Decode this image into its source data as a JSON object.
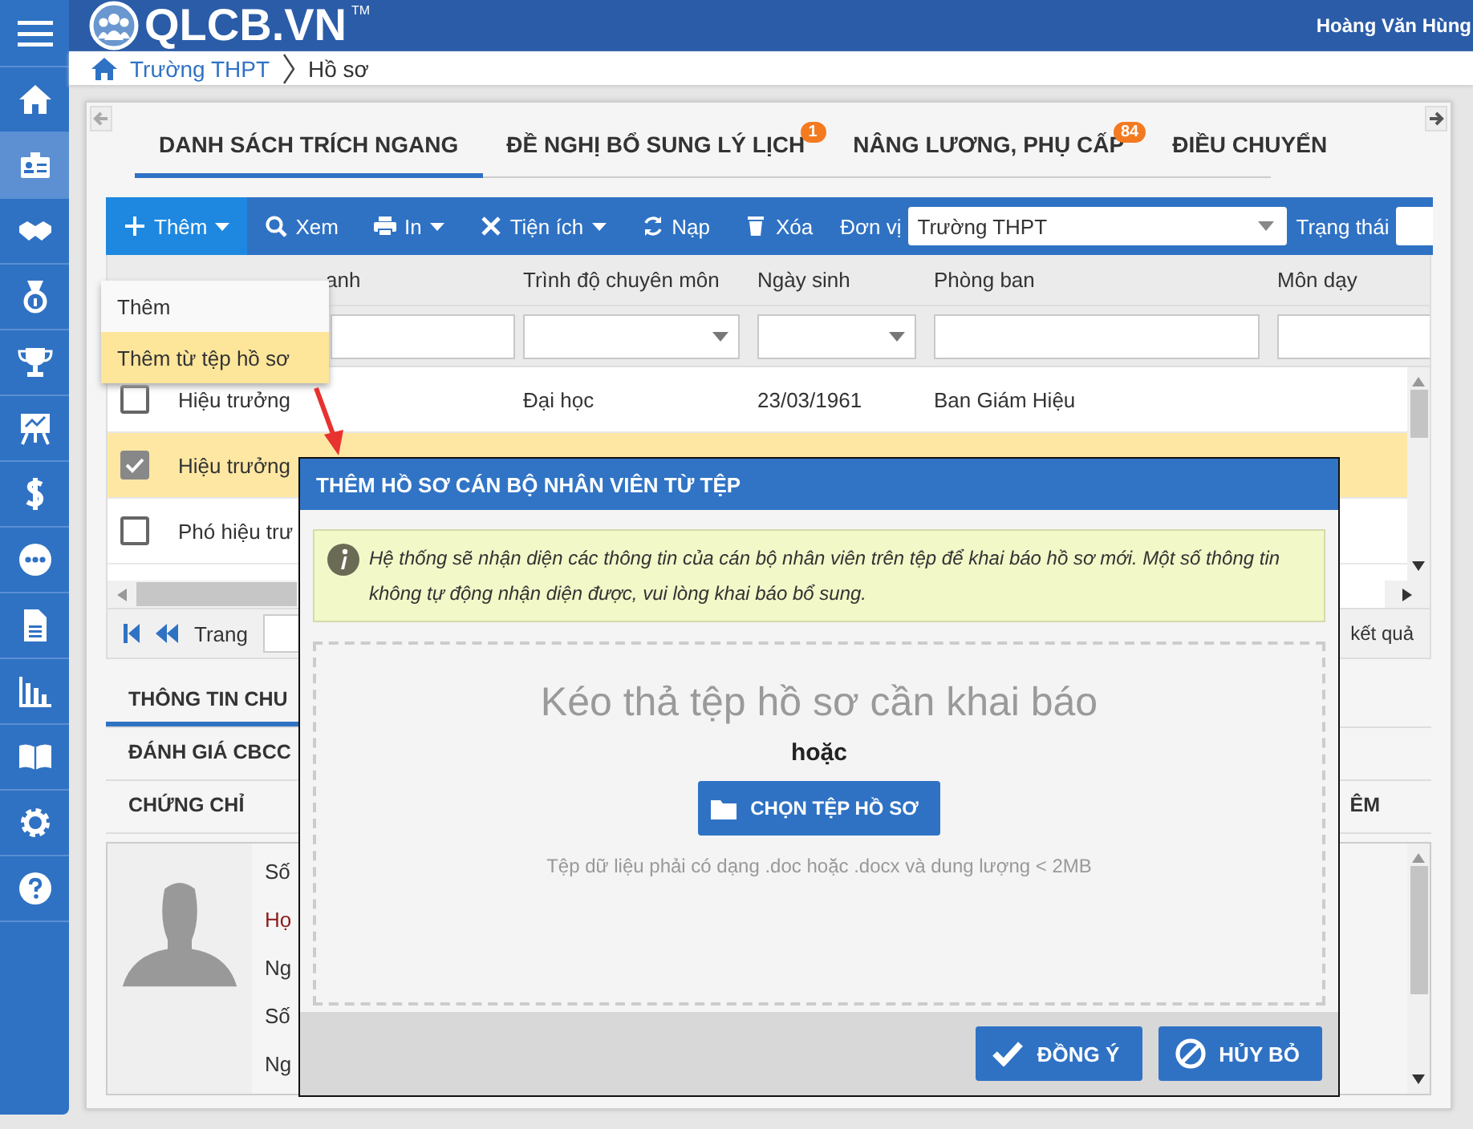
{
  "header": {
    "logo": "QLCB.VN",
    "trademark": "TM",
    "user": "Hoàng Văn Hùng"
  },
  "sidebar": {
    "items": [
      {
        "selected": false
      },
      {
        "selected": true
      },
      {
        "selected": false
      },
      {
        "selected": false
      },
      {
        "selected": false
      },
      {
        "selected": false
      },
      {
        "selected": false
      },
      {
        "selected": false
      },
      {
        "selected": false
      },
      {
        "selected": false
      },
      {
        "selected": false
      },
      {
        "selected": false
      },
      {
        "selected": false
      }
    ]
  },
  "breadcrumb": [
    "Trường THPT",
    "Hồ sơ"
  ],
  "tabs": [
    {
      "label": "DANH SÁCH TRÍCH NGANG",
      "selected": true
    },
    {
      "label": "ĐỀ NGHỊ BỔ SUNG LÝ LỊCH",
      "badge": "1",
      "selected": false
    },
    {
      "label": "NÂNG LƯƠNG, PHỤ CẤP",
      "badge": "84",
      "selected": false
    },
    {
      "label": "ĐIỀU CHUYỂN",
      "selected": false
    }
  ],
  "toolbar": {
    "buttons": [
      {
        "kind": "add",
        "label": "Thêm",
        "caret": true,
        "active": true
      },
      {
        "kind": "view",
        "label": "Xem",
        "caret": false,
        "active": false
      },
      {
        "kind": "print",
        "label": "In",
        "caret": true,
        "active": false
      },
      {
        "kind": "tools",
        "label": "Tiện ích",
        "caret": true,
        "active": false
      },
      {
        "kind": "reload",
        "label": "Nạp",
        "caret": false,
        "active": false
      },
      {
        "kind": "delete",
        "label": "Xóa",
        "caret": false,
        "active": false
      }
    ],
    "unit_label": "Đơn vị",
    "unit_value": "Trường THPT",
    "status_label": "Trạng thái"
  },
  "add_menu": [
    {
      "label": "Thêm",
      "selected": false
    },
    {
      "label": "Thêm từ tệp hồ sơ",
      "selected": true
    }
  ],
  "table": {
    "columns": [
      "anh",
      "Trình độ chuyên môn",
      "Ngày sinh",
      "Phòng ban",
      "Môn dạy"
    ],
    "rows": [
      {
        "checked": false,
        "selected": false,
        "cells": [
          "Hiệu trưởng",
          "Đại học",
          "23/03/1961",
          "Ban Giám Hiệu"
        ]
      },
      {
        "checked": true,
        "selected": true,
        "cells": [
          "Hiệu trưởng"
        ]
      },
      {
        "checked": false,
        "selected": false,
        "cells": [
          "Phó hiệu trư"
        ]
      }
    ]
  },
  "pager": {
    "label": "Trang",
    "result": "kết quả"
  },
  "detail_tabs": [
    [
      {
        "label": "THÔNG TIN CHU",
        "selected": true
      }
    ],
    [
      {
        "label": "ĐÁNH GIÁ CBCC",
        "selected": false
      }
    ],
    [
      {
        "label": "CHỨNG CHỈ",
        "selected": false
      },
      {
        "label": "ÊM",
        "selected": false
      }
    ]
  ],
  "profile": {
    "fields": [
      {
        "label": "Số",
        "required": false
      },
      {
        "label": "Họ",
        "required": true
      },
      {
        "label": "Ng",
        "required": false
      },
      {
        "label": "Số",
        "required": false
      },
      {
        "label": "Ng",
        "required": false
      }
    ]
  },
  "dialog": {
    "title": "THÊM HỒ SƠ CÁN BỘ NHÂN VIÊN TỪ TỆP",
    "info": "Hệ thống sẽ nhận diện các thông tin của cán bộ nhân viên trên tệp để khai báo hồ sơ mới. Một số thông tin không tự động nhận diện được, vui lòng khai báo bổ sung.",
    "drop_text": "Kéo thả tệp hồ sơ cần khai báo",
    "or_text": "hoặc",
    "choose_button": "CHỌN TỆP HỒ SƠ",
    "hint": "Tệp dữ liệu phải có dạng .doc hoặc .docx và dung lượng < 2MB",
    "buttons": [
      {
        "kind": "ok",
        "label": "ĐỒNG Ý"
      },
      {
        "kind": "cancel",
        "label": "HỦY BỎ"
      }
    ]
  }
}
